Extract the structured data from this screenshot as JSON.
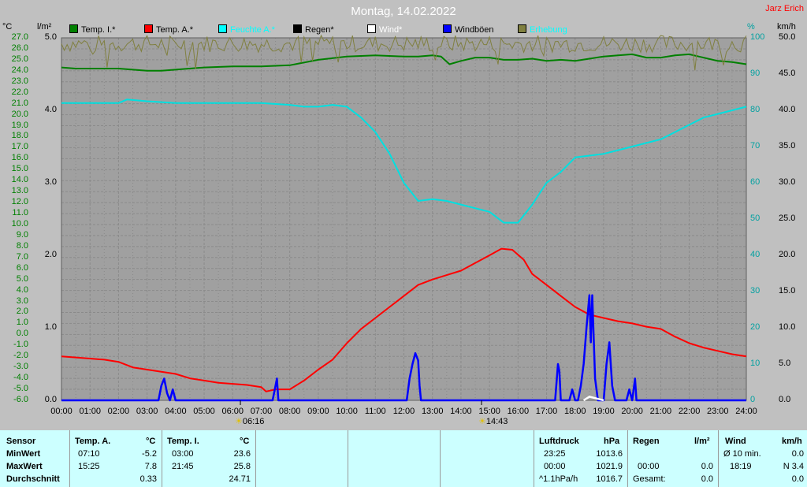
{
  "header": {
    "title": "Montag, 14.02.2022",
    "author": "Jarz Erich"
  },
  "units": {
    "temp": "°C",
    "rain": "l/m²",
    "humidity": "%",
    "wind": "km/h"
  },
  "legend": [
    {
      "label": "Temp. I.*",
      "color": "#008000",
      "text_color": "#000000"
    },
    {
      "label": "Temp. A.*",
      "color": "#ff0000",
      "text_color": "#000000"
    },
    {
      "label": "Feuchte A.*",
      "color": "#00ffff",
      "text_color": "#00ffff"
    },
    {
      "label": "Regen*",
      "color": "#000000",
      "text_color": "#000000"
    },
    {
      "label": "Wind*",
      "color": "#ffffff",
      "text_color": "#ffffff"
    },
    {
      "label": "Windböen",
      "color": "#0000ff",
      "text_color": "#000000"
    },
    {
      "label": "Erhebung",
      "color": "#808040",
      "text_color": "#00ffff"
    }
  ],
  "colors": {
    "background": "#c0c0c0",
    "plot": "#a0a0a0",
    "grid": "#8a8a8a",
    "temp_axis": "#008000",
    "hum_axis": "#00a0a0"
  },
  "sun": {
    "sunrise": "06:16",
    "sunset": "14:43"
  },
  "chart_data": {
    "type": "line",
    "title": "Montag, 14.02.2022",
    "x_ticks": [
      "00:00",
      "01:00",
      "02:00",
      "03:00",
      "04:00",
      "05:00",
      "06:00",
      "07:00",
      "08:00",
      "09:00",
      "10:00",
      "11:00",
      "12:00",
      "13:00",
      "14:00",
      "15:00",
      "16:00",
      "17:00",
      "18:00",
      "19:00",
      "20:00",
      "21:00",
      "22:00",
      "23:00",
      "24:00"
    ],
    "x_range_hours": [
      0,
      24
    ],
    "axes": {
      "temp": {
        "unit": "°C",
        "range": [
          -6,
          27
        ],
        "ticks": [
          "27.0",
          "26.0",
          "25.0",
          "24.0",
          "23.0",
          "22.0",
          "21.0",
          "20.0",
          "19.0",
          "18.0",
          "17.0",
          "16.0",
          "15.0",
          "14.0",
          "13.0",
          "12.0",
          "11.0",
          "10.0",
          "9.0",
          "8.0",
          "7.0",
          "6.0",
          "5.0",
          "4.0",
          "3.0",
          "2.0",
          "1.0",
          "0.0",
          "-1.0",
          "-2.0",
          "-3.0",
          "-4.0",
          "-5.0",
          "-6.0"
        ]
      },
      "rain": {
        "unit": "l/m²",
        "range": [
          0,
          5
        ],
        "ticks": [
          "5.0",
          "4.0",
          "3.0",
          "2.0",
          "1.0",
          "0.0"
        ]
      },
      "humidity": {
        "unit": "%",
        "range": [
          0,
          100
        ],
        "ticks": [
          "100",
          "90",
          "80",
          "70",
          "60",
          "50",
          "40",
          "30",
          "20",
          "10",
          "0"
        ]
      },
      "wind": {
        "unit": "km/h",
        "range": [
          0,
          50
        ],
        "ticks": [
          "50.0",
          "45.0",
          "40.0",
          "35.0",
          "30.0",
          "25.0",
          "20.0",
          "15.0",
          "10.0",
          "5.0",
          "0.0"
        ]
      }
    },
    "grid": true,
    "series": [
      {
        "name": "Temp. I.*",
        "axis": "temp",
        "color": "#008000",
        "points": [
          [
            0,
            24.3
          ],
          [
            0.5,
            24.2
          ],
          [
            1,
            24.2
          ],
          [
            2,
            24.2
          ],
          [
            3,
            24.0
          ],
          [
            3.5,
            24.0
          ],
          [
            4,
            24.1
          ],
          [
            5,
            24.3
          ],
          [
            6,
            24.4
          ],
          [
            7,
            24.4
          ],
          [
            8,
            24.5
          ],
          [
            9,
            25.0
          ],
          [
            10,
            25.3
          ],
          [
            11,
            25.4
          ],
          [
            12,
            25.3
          ],
          [
            12.5,
            25.3
          ],
          [
            13,
            25.4
          ],
          [
            13.3,
            25.3
          ],
          [
            13.6,
            24.6
          ],
          [
            14,
            24.9
          ],
          [
            14.5,
            25.2
          ],
          [
            15,
            25.2
          ],
          [
            15.5,
            25.0
          ],
          [
            16,
            25.0
          ],
          [
            16.5,
            25.1
          ],
          [
            17,
            24.9
          ],
          [
            17.5,
            25.0
          ],
          [
            18,
            24.9
          ],
          [
            18.5,
            25.1
          ],
          [
            19,
            25.3
          ],
          [
            19.5,
            25.4
          ],
          [
            20,
            25.5
          ],
          [
            20.5,
            25.2
          ],
          [
            21,
            25.2
          ],
          [
            21.5,
            25.4
          ],
          [
            22,
            25.5
          ],
          [
            22.5,
            25.2
          ],
          [
            23,
            24.9
          ],
          [
            23.5,
            24.8
          ],
          [
            24,
            24.6
          ]
        ]
      },
      {
        "name": "Temp. A.*",
        "axis": "temp",
        "color": "#ff0000",
        "points": [
          [
            0,
            -2.0
          ],
          [
            0.5,
            -2.1
          ],
          [
            1,
            -2.2
          ],
          [
            1.5,
            -2.3
          ],
          [
            2,
            -2.5
          ],
          [
            2.5,
            -3.0
          ],
          [
            3,
            -3.2
          ],
          [
            3.5,
            -3.4
          ],
          [
            4,
            -3.6
          ],
          [
            4.5,
            -4.0
          ],
          [
            5,
            -4.2
          ],
          [
            5.5,
            -4.4
          ],
          [
            6,
            -4.5
          ],
          [
            6.5,
            -4.6
          ],
          [
            7,
            -4.8
          ],
          [
            7.17,
            -5.2
          ],
          [
            7.5,
            -5.0
          ],
          [
            8,
            -5.0
          ],
          [
            8.5,
            -4.2
          ],
          [
            9,
            -3.2
          ],
          [
            9.5,
            -2.3
          ],
          [
            10,
            -0.8
          ],
          [
            10.5,
            0.5
          ],
          [
            11,
            1.5
          ],
          [
            11.5,
            2.5
          ],
          [
            12,
            3.5
          ],
          [
            12.5,
            4.5
          ],
          [
            13,
            5.0
          ],
          [
            13.5,
            5.4
          ],
          [
            14,
            5.8
          ],
          [
            14.5,
            6.5
          ],
          [
            15,
            7.2
          ],
          [
            15.42,
            7.8
          ],
          [
            15.8,
            7.7
          ],
          [
            16.2,
            6.8
          ],
          [
            16.5,
            5.5
          ],
          [
            17,
            4.5
          ],
          [
            17.5,
            3.5
          ],
          [
            18,
            2.5
          ],
          [
            18.5,
            1.8
          ],
          [
            19,
            1.5
          ],
          [
            19.5,
            1.2
          ],
          [
            20,
            1.0
          ],
          [
            20.5,
            0.7
          ],
          [
            21,
            0.5
          ],
          [
            21.5,
            -0.2
          ],
          [
            22,
            -0.8
          ],
          [
            22.5,
            -1.2
          ],
          [
            23,
            -1.5
          ],
          [
            23.5,
            -1.8
          ],
          [
            24,
            -2.0
          ]
        ]
      },
      {
        "name": "Feuchte A.*",
        "axis": "humidity",
        "color": "#00e0e0",
        "points": [
          [
            0,
            82
          ],
          [
            1,
            82
          ],
          [
            2,
            82
          ],
          [
            2.3,
            83
          ],
          [
            3,
            82.5
          ],
          [
            4,
            82
          ],
          [
            5,
            82
          ],
          [
            6,
            82
          ],
          [
            7,
            82
          ],
          [
            8,
            81.5
          ],
          [
            8.5,
            81
          ],
          [
            9,
            81
          ],
          [
            9.5,
            81.5
          ],
          [
            10,
            81
          ],
          [
            10.5,
            78
          ],
          [
            11,
            74
          ],
          [
            11.5,
            68
          ],
          [
            12,
            60
          ],
          [
            12.5,
            55
          ],
          [
            13,
            55.5
          ],
          [
            13.5,
            55
          ],
          [
            14,
            54
          ],
          [
            15,
            52
          ],
          [
            15.5,
            49
          ],
          [
            16,
            49
          ],
          [
            16.5,
            54
          ],
          [
            17,
            60
          ],
          [
            17.5,
            63
          ],
          [
            18,
            67
          ],
          [
            18.5,
            67.5
          ],
          [
            19,
            68
          ],
          [
            19.5,
            69
          ],
          [
            20,
            70
          ],
          [
            20.5,
            71
          ],
          [
            21,
            72
          ],
          [
            21.5,
            74
          ],
          [
            22,
            76
          ],
          [
            22.5,
            78
          ],
          [
            23,
            79
          ],
          [
            23.5,
            80
          ],
          [
            24,
            81
          ]
        ]
      },
      {
        "name": "Windböen",
        "axis": "wind",
        "color": "#0000ff",
        "points": [
          [
            0,
            0
          ],
          [
            3.4,
            0
          ],
          [
            3.5,
            2
          ],
          [
            3.6,
            3
          ],
          [
            3.7,
            1
          ],
          [
            3.8,
            0
          ],
          [
            3.9,
            1.5
          ],
          [
            4.0,
            0
          ],
          [
            7.4,
            0
          ],
          [
            7.5,
            2
          ],
          [
            7.55,
            3
          ],
          [
            7.6,
            0
          ],
          [
            12.1,
            0
          ],
          [
            12.2,
            3
          ],
          [
            12.3,
            5
          ],
          [
            12.4,
            6.5
          ],
          [
            12.5,
            5.5
          ],
          [
            12.55,
            2
          ],
          [
            12.6,
            0
          ],
          [
            17.3,
            0
          ],
          [
            17.4,
            5
          ],
          [
            17.45,
            4
          ],
          [
            17.5,
            0
          ],
          [
            17.8,
            0
          ],
          [
            17.9,
            1.5
          ],
          [
            18.0,
            0
          ],
          [
            18.1,
            0
          ],
          [
            18.2,
            2
          ],
          [
            18.3,
            5
          ],
          [
            18.4,
            10
          ],
          [
            18.5,
            14.5
          ],
          [
            18.55,
            8
          ],
          [
            18.6,
            14.5
          ],
          [
            18.7,
            3
          ],
          [
            18.8,
            0
          ],
          [
            19.0,
            0
          ],
          [
            19.1,
            5
          ],
          [
            19.2,
            8
          ],
          [
            19.3,
            2
          ],
          [
            19.4,
            0
          ],
          [
            19.8,
            0
          ],
          [
            19.9,
            1.5
          ],
          [
            20.0,
            0
          ],
          [
            20.1,
            3
          ],
          [
            20.15,
            0
          ],
          [
            24,
            0
          ]
        ]
      },
      {
        "name": "Wind*",
        "axis": "wind",
        "color": "#ffffff",
        "points": [
          [
            18.3,
            0
          ],
          [
            18.5,
            0.5
          ],
          [
            18.7,
            0.3
          ],
          [
            19.0,
            0
          ]
        ]
      },
      {
        "name": "Erhebung",
        "axis": "wind",
        "color": "#808040",
        "level": 49.2,
        "noise": 1.2,
        "note": "noisy trace near 49 km/h"
      }
    ]
  },
  "table": {
    "rows": [
      "Sensor",
      "MinWert",
      "MaxWert",
      "Durchschnitt"
    ],
    "temp_a": {
      "header": "Temp. A.",
      "unit": "°C",
      "min_time": "07:10",
      "min": "-5.2",
      "max_time": "15:25",
      "max": "7.8",
      "avg": "0.33"
    },
    "temp_i": {
      "header": "Temp. I.",
      "unit": "°C",
      "min_time": "03:00",
      "min": "23.6",
      "max_time": "21:45",
      "max": "25.8",
      "avg": "24.71"
    },
    "pressure": {
      "header": "Luftdruck",
      "unit": "hPa",
      "min_time": "23:25",
      "min": "1013.6",
      "max_time": "00:00",
      "max": "1021.9",
      "trend": "^1.1hPa/h",
      "avg": "1016.7"
    },
    "rain": {
      "header": "Regen",
      "unit": "l/m²",
      "max_time": "00:00",
      "max": "0.0",
      "total_label": "Gesamt:",
      "total": "0.0"
    },
    "wind": {
      "header": "Wind",
      "unit": "km/h",
      "avg_label": "Ø 10 min.",
      "avg": "0.0",
      "max_time": "18:19",
      "max": "N 3.4",
      "mean": "0.0"
    }
  }
}
